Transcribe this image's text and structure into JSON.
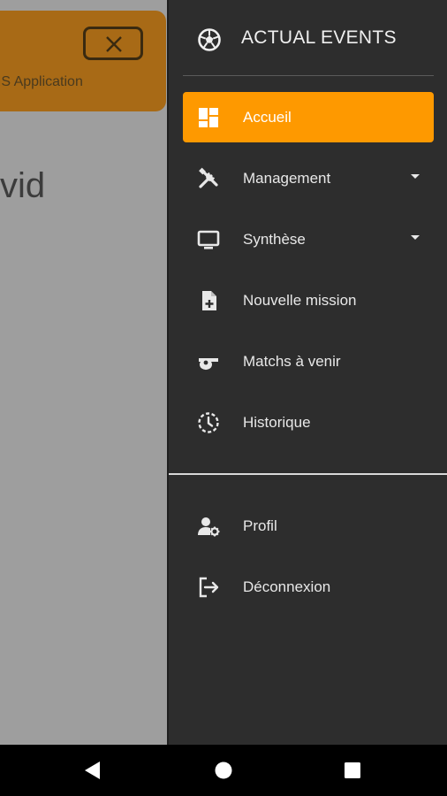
{
  "background": {
    "banner_text": "MS Application",
    "greeting": "vid"
  },
  "drawer": {
    "title": "ACTUAL EVENTS",
    "brand_icon": "soccer-ball-icon",
    "accent_color": "#fe9900",
    "items": [
      {
        "label": "Accueil",
        "icon": "dashboard-icon",
        "active": true
      },
      {
        "label": "Management",
        "icon": "tools-icon",
        "dropdown": true
      },
      {
        "label": "Synthèse",
        "icon": "monitor-icon",
        "dropdown": true
      },
      {
        "label": "Nouvelle mission",
        "icon": "file-add-icon"
      },
      {
        "label": "Matchs à venir",
        "icon": "whistle-icon"
      },
      {
        "label": "Historique",
        "icon": "history-clock-icon"
      }
    ],
    "footer_items": [
      {
        "label": "Profil",
        "icon": "user-settings-icon"
      },
      {
        "label": "Déconnexion",
        "icon": "logout-icon"
      }
    ]
  },
  "system_nav": {
    "buttons": [
      "back-icon",
      "home-icon",
      "recents-icon"
    ]
  }
}
